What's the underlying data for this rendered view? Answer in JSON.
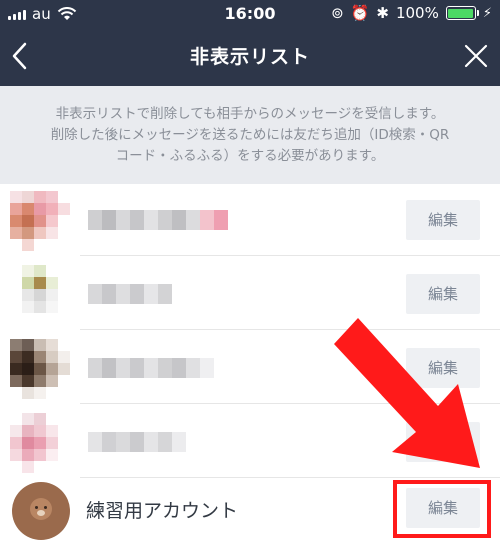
{
  "status_bar": {
    "carrier": "au",
    "time": "16:00",
    "battery_percent": "100%",
    "battery_level": 1.0,
    "colors": {
      "battery_fill": "#4cd964"
    }
  },
  "nav": {
    "title": "非表示リスト",
    "back_icon": "chevron-left-icon",
    "close_icon": "close-icon"
  },
  "notice": {
    "lines": [
      "非表示リストで削除しても相手からのメッセージを受信します。",
      "削除した後にメッセージを送るためには友だち追加（ID検索・QR",
      "コード・ふるふる）をする必要があります。"
    ]
  },
  "list": {
    "edit_label": "編集",
    "rows": [
      {
        "edit_label": "編集"
      },
      {
        "edit_label": "編集"
      },
      {
        "edit_label": "編集"
      },
      {
        "edit_label": "編集"
      },
      {
        "name": "練習用アカウント",
        "edit_label": "編集"
      }
    ]
  },
  "colors": {
    "header_bg": "#2d3649",
    "notice_bg": "#e9ebef",
    "edit_button_bg": "#eef0f3",
    "annotation_red": "#ff1a1a"
  }
}
